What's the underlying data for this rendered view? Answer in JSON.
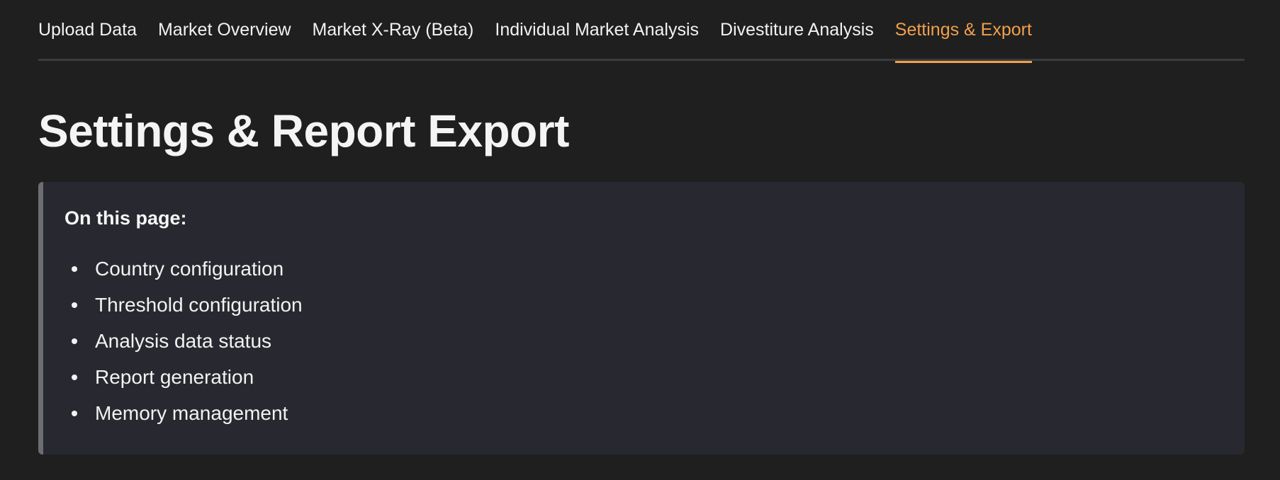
{
  "tabs": [
    {
      "label": "Upload Data",
      "active": false
    },
    {
      "label": "Market Overview",
      "active": false
    },
    {
      "label": "Market X-Ray (Beta)",
      "active": false
    },
    {
      "label": "Individual Market Analysis",
      "active": false
    },
    {
      "label": "Divestiture Analysis",
      "active": false
    },
    {
      "label": "Settings & Export",
      "active": true
    }
  ],
  "page": {
    "title": "Settings & Report Export"
  },
  "info_box": {
    "heading": "On this page:",
    "items": [
      "Country configuration",
      "Threshold configuration",
      "Analysis data status",
      "Report generation",
      "Memory management"
    ]
  },
  "colors": {
    "background": "#1f1f1f",
    "accent": "#f0a04b",
    "info_box_bg": "#282930",
    "info_box_border": "#6c6d73"
  }
}
